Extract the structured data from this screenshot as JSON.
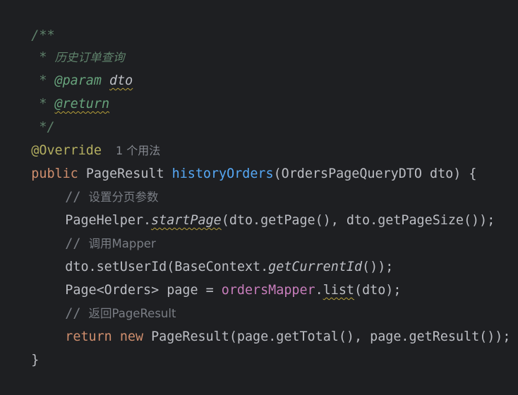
{
  "editor": {
    "background": "#1e1f22",
    "lines": [
      {
        "doc_open": "/**"
      },
      {
        "doc_star": " * ",
        "doc_text": "历史订单查询"
      },
      {
        "doc_star": " * ",
        "doc_tag": "@param",
        "doc_space": " ",
        "doc_arg": "dto"
      },
      {
        "doc_star": " * ",
        "doc_tag": "@return"
      },
      {
        "doc_close": " */"
      },
      {
        "annotation": "@Override",
        "usage_hint": "1 个用法"
      },
      {
        "kw_public": "public",
        "type": "PageResult",
        "method": "historyOrders",
        "params": "(OrdersPageQueryDTO dto) {"
      },
      {
        "comment_prefix": "// ",
        "comment_text": "设置分页参数"
      },
      {
        "class_name": "PageHelper.",
        "static_call": "startPage",
        "rest": "(dto.getPage(), dto.getPageSize());"
      },
      {
        "comment_prefix": "// ",
        "comment_text": "调用Mapper"
      },
      {
        "call": "dto.setUserId(BaseContext.",
        "static_call": "getCurrentId",
        "rest": "());"
      },
      {
        "decl": "Page<Orders> page = ",
        "field": "ordersMapper",
        "dot": ".",
        "call": "list",
        "rest": "(dto);"
      },
      {
        "comment_prefix": "// ",
        "comment_text": "返回PageResult"
      },
      {
        "kw_return": "return",
        "kw_new": "new",
        "rest": "PageResult(page.getTotal(), page.getResult());"
      },
      {
        "brace": "}"
      }
    ]
  },
  "colors": {
    "background": "#1e1f22",
    "plain": "#bcbec4",
    "doc_comment": "#5f826b",
    "doc_tag": "#67a37c",
    "line_comment": "#7a7e85",
    "annotation": "#b3ae60",
    "keyword": "#cf8e6d",
    "method_declaration": "#56a8f5",
    "field": "#c77dbb",
    "warning_squiggle": "#b8a13a"
  }
}
